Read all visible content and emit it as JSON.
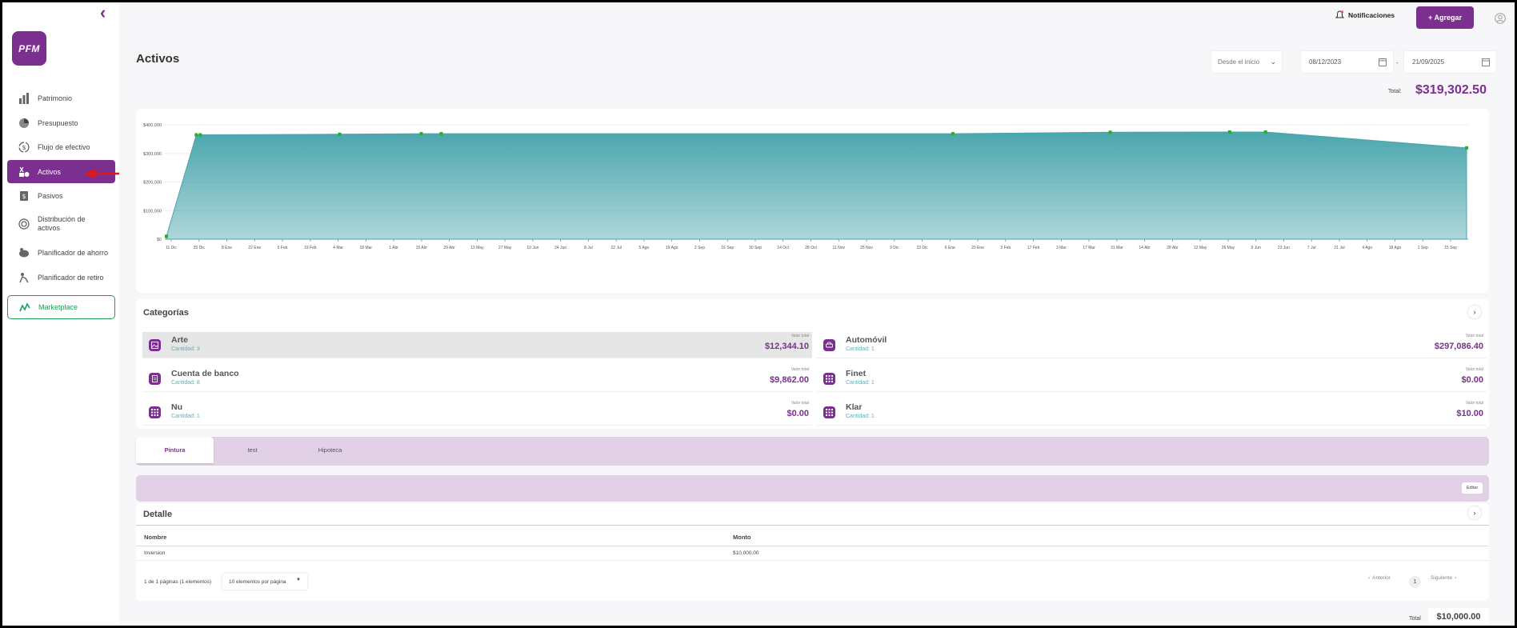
{
  "sidebar": {
    "logo_text": "PFM",
    "items": [
      {
        "label": "Patrimonio",
        "icon": "bar-chart-icon"
      },
      {
        "label": "Presupuesto",
        "icon": "pie-chart-icon"
      },
      {
        "label": "Flujo de efectivo",
        "icon": "dollar-cycle-icon"
      },
      {
        "label": "Activos",
        "icon": "assets-icon"
      },
      {
        "label": "Pasivos",
        "icon": "liabilities-icon"
      },
      {
        "label": "Distribución de activos",
        "icon": "distribution-icon"
      },
      {
        "label": "Planificador de ahorro",
        "icon": "piggy-bank-icon"
      },
      {
        "label": "Planificador de retiro",
        "icon": "retirement-icon"
      }
    ],
    "marketplace_label": "Marketplace"
  },
  "header": {
    "notifications_label": "Notificaciones",
    "add_label": "+ Agregar"
  },
  "page": {
    "title": "Activos",
    "range_select": "Desde el inicio",
    "date_from": "08/12/2023",
    "date_to": "21/09/2025",
    "date_sep": "-",
    "total_label": "Total:",
    "total_value": "$319,302.50"
  },
  "chart_data": {
    "type": "area",
    "color": "#4aa6ad",
    "ylim": [
      0,
      400000
    ],
    "ytick_labels": [
      "$0",
      "$100,000",
      "$200,000",
      "$300,000",
      "$400,000"
    ],
    "xtick_labels": [
      "11 Dic",
      "25 Dic",
      "8 Ene",
      "22 Ene",
      "5 Feb",
      "19 Feb",
      "4 Mar",
      "18 Mar",
      "1 Abr",
      "15 Abr",
      "29 Abr",
      "13 May",
      "27 May",
      "10 Jun",
      "24 Jun",
      "8 Jul",
      "22 Jul",
      "5 Ago",
      "19 Ago",
      "2 Sep",
      "16 Sep",
      "30 Sep",
      "14 Oct",
      "28 Oct",
      "11 Nov",
      "25 Nov",
      "9 Dic",
      "23 Dic",
      "6 Ene",
      "20 Ene",
      "3 Feb",
      "17 Feb",
      "3 Mar",
      "17 Mar",
      "31 Mar",
      "14 Abr",
      "28 Abr",
      "12 May",
      "26 May",
      "9 Jun",
      "23 Jun",
      "7 Jul",
      "21 Jul",
      "4 Ago",
      "18 Ago",
      "1 Sep",
      "15 Sep"
    ],
    "points": [
      {
        "x": "2023-12-08",
        "y": 10000
      },
      {
        "x": "2023-12-23",
        "y": 365000
      },
      {
        "x": "2023-12-25",
        "y": 365000
      },
      {
        "x": "2024-03-04",
        "y": 367000
      },
      {
        "x": "2024-04-14",
        "y": 369000
      },
      {
        "x": "2024-04-24",
        "y": 369000
      },
      {
        "x": "2025-01-06",
        "y": 369000
      },
      {
        "x": "2025-03-26",
        "y": 374000
      },
      {
        "x": "2025-05-25",
        "y": 375000
      },
      {
        "x": "2025-06-12",
        "y": 375000
      },
      {
        "x": "2025-09-21",
        "y": 319302.5
      }
    ]
  },
  "categories": {
    "title": "Categorías",
    "value_label": "Valor total",
    "items": [
      {
        "name": "Arte",
        "count": "Cantidad: 3",
        "value": "$12,344.10"
      },
      {
        "name": "Automóvil",
        "count": "Cantidad: 1",
        "value": "$297,086.40"
      },
      {
        "name": "Cuenta de banco",
        "count": "Cantidad: 8",
        "value": "$9,862.00"
      },
      {
        "name": "Finet",
        "count": "Cantidad: 1",
        "value": "$0.00"
      },
      {
        "name": "Nu",
        "count": "Cantidad: 1",
        "value": "$0.00"
      },
      {
        "name": "Klar",
        "count": "Cantidad: 1",
        "value": "$10.00"
      }
    ]
  },
  "tabs": [
    "Pintura",
    "test",
    "Hipoteca"
  ],
  "edit_label": "Editar",
  "detail": {
    "title": "Detalle",
    "columns": [
      "Nombre",
      "Monto"
    ],
    "rows": [
      [
        "Inversion",
        "$10,000.00"
      ]
    ],
    "pagination_info": "1 de 1 páginas (1 elementos)",
    "per_page": "10 elementos por página",
    "prev_label": "Anterior",
    "page_number": "1",
    "next_label": "Siguiente",
    "total_label": "Total",
    "total_value": "$10,000.00"
  }
}
